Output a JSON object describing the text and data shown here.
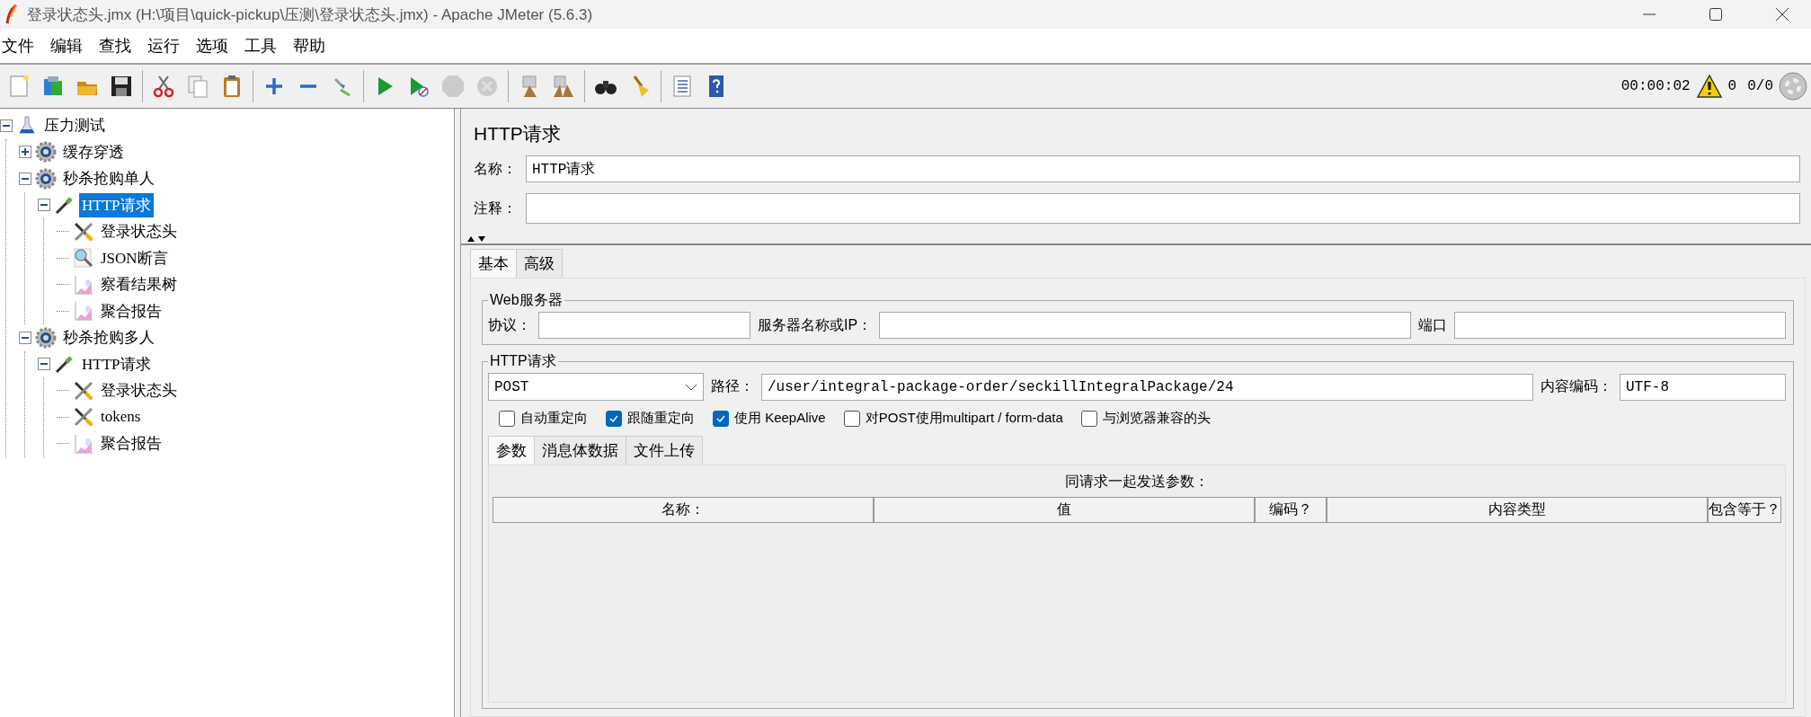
{
  "window": {
    "title": "登录状态头.jmx (H:\\项目\\quick-pickup\\压测\\登录状态头.jmx) - Apache JMeter (5.6.3)"
  },
  "menu": [
    "文件",
    "编辑",
    "查找",
    "运行",
    "选项",
    "工具",
    "帮助"
  ],
  "toolbar": {
    "buttons": [
      {
        "disabled": false
      },
      {
        "disabled": false
      },
      {
        "disabled": false
      },
      {
        "disabled": false
      },
      {
        "disabled": false
      },
      {
        "disabled": false
      },
      {
        "disabled": false
      },
      {
        "disabled": false
      },
      {
        "disabled": false
      },
      {
        "disabled": false
      },
      {
        "disabled": false
      },
      {
        "disabled": false
      },
      {
        "disabled": true
      },
      {
        "disabled": true
      },
      {
        "disabled": false
      },
      {
        "disabled": false
      },
      {
        "disabled": false
      },
      {
        "disabled": false
      },
      {
        "disabled": false
      },
      {
        "disabled": false
      }
    ],
    "timer": "00:00:02",
    "warnings": "0",
    "threads": "0/0"
  },
  "tree": [
    {
      "label": "压力测试",
      "kind": "plan",
      "expanded": true,
      "selected": false,
      "children": [
        {
          "label": "缓存穿透",
          "kind": "thread-group",
          "expanded": false,
          "selected": false
        },
        {
          "label": "秒杀抢购单人",
          "kind": "thread-group",
          "expanded": true,
          "selected": false,
          "children": [
            {
              "label": "HTTP请求",
              "kind": "sampler",
              "expanded": true,
              "selected": true,
              "children": [
                {
                  "label": "登录状态头",
                  "kind": "config",
                  "selected": false
                },
                {
                  "label": "JSON断言",
                  "kind": "assertion",
                  "selected": false
                },
                {
                  "label": "察看结果树",
                  "kind": "listener",
                  "selected": false
                },
                {
                  "label": "聚合报告",
                  "kind": "listener",
                  "selected": false
                }
              ]
            }
          ]
        },
        {
          "label": "秒杀抢购多人",
          "kind": "thread-group",
          "expanded": true,
          "selected": false,
          "children": [
            {
              "label": "HTTP请求",
              "kind": "sampler",
              "expanded": true,
              "selected": false,
              "children": [
                {
                  "label": "登录状态头",
                  "kind": "config",
                  "selected": false
                },
                {
                  "label": "tokens",
                  "kind": "config",
                  "selected": false
                },
                {
                  "label": "聚合报告",
                  "kind": "listener",
                  "selected": false
                }
              ]
            }
          ]
        }
      ]
    }
  ],
  "editor": {
    "title": "HTTP请求",
    "name_label": "名称：",
    "name_value": "HTTP请求",
    "comment_label": "注释：",
    "tabs": [
      {
        "label": "基本",
        "selected": true
      },
      {
        "label": "高级",
        "selected": false
      }
    ],
    "web_server": {
      "legend": "Web服务器",
      "protocol_label": "协议：",
      "server_label": "服务器名称或IP：",
      "port_label": "端口"
    },
    "http_request": {
      "legend": "HTTP请求",
      "method": "POST",
      "path_label": "路径：",
      "path": "/user/integral-package-order/seckillIntegralPackage/24",
      "encoding_label": "内容编码：",
      "encoding": "UTF-8",
      "options": [
        {
          "label": "自动重定向",
          "checked": false
        },
        {
          "label": "跟随重定向",
          "checked": true
        },
        {
          "label": "使用 KeepAlive",
          "checked": true
        },
        {
          "label": "对POST使用multipart / form-data",
          "checked": false
        },
        {
          "label": "与浏览器兼容的头",
          "checked": false
        }
      ],
      "tabs": [
        {
          "label": "参数",
          "selected": true
        },
        {
          "label": "消息体数据",
          "selected": false
        },
        {
          "label": "文件上传",
          "selected": false
        }
      ],
      "params": {
        "caption": "同请求一起发送参数：",
        "columns": [
          {
            "label": "名称：",
            "wide": true
          },
          {
            "label": "值",
            "wide": true
          },
          {
            "label": "编码？",
            "wide": false
          },
          {
            "label": "内容类型",
            "wide": true
          },
          {
            "label": "包含等于？",
            "wide": false
          }
        ]
      }
    }
  }
}
